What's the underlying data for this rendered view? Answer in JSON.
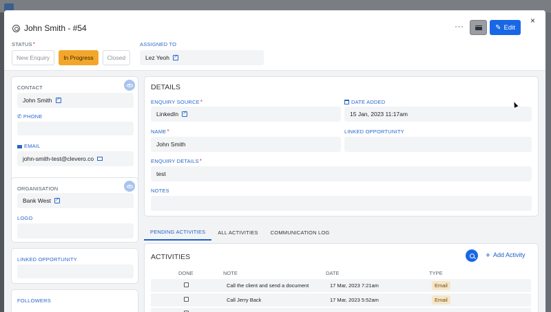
{
  "header": {
    "title": "John Smith - #54",
    "more_label": "···",
    "edit_label": "Edit",
    "close_label": "×"
  },
  "status": {
    "label": "STATUS",
    "required_mark": "*",
    "options": [
      "New Enquiry",
      "In Progress",
      "Closed"
    ],
    "selected": "In Progress",
    "accent_color": "#f2a72c"
  },
  "assigned": {
    "label": "ASSIGNED TO",
    "value": "Lez Yeoh"
  },
  "contact_card": {
    "contact_label": "CONTACT",
    "contact_value": "John Smith",
    "phone_label": "PHONE",
    "phone_value": "",
    "email_label": "EMAIL",
    "email_value": "john-smith-test@clevero.co"
  },
  "organisation_card": {
    "organisation_label": "ORGANISATION",
    "organisation_value": "Bank West",
    "logo_label": "LOGO"
  },
  "linked_card": {
    "label": "LINKED OPPORTUNITY"
  },
  "followers_card": {
    "label": "FOLLOWERS"
  },
  "details": {
    "title": "DETAILS",
    "source_label": "ENQUIRY SOURCE",
    "source_value": "LinkedIn",
    "date_label": "DATE ADDED",
    "date_value": "15 Jan, 2023  11:17am",
    "name_label": "NAME",
    "name_value": "John Smith",
    "linked_label": "LINKED OPPORTUNITY",
    "enquiry_details_label": "ENQUIRY DETAILS",
    "enquiry_details_value": "test",
    "notes_label": "NOTES"
  },
  "tabs": [
    "PENDING ACTIVITIES",
    "ALL ACTIVITIES",
    "COMMUNICATION LOG"
  ],
  "activities": {
    "title": "ACTIVITIES",
    "add_label": "Add Activity",
    "columns": [
      "DONE",
      "NOTE",
      "DATE",
      "TYPE"
    ],
    "rows": [
      {
        "note": "Call the client and send a document",
        "date": "17 Mar, 2023  7:21am",
        "type": "Email"
      },
      {
        "note": "Call Jerry Back",
        "date": "17 Mar, 2023  5:52am",
        "type": "Email"
      }
    ]
  },
  "colors": {
    "primary": "#1967e6",
    "badge": "#f6e6c6"
  }
}
